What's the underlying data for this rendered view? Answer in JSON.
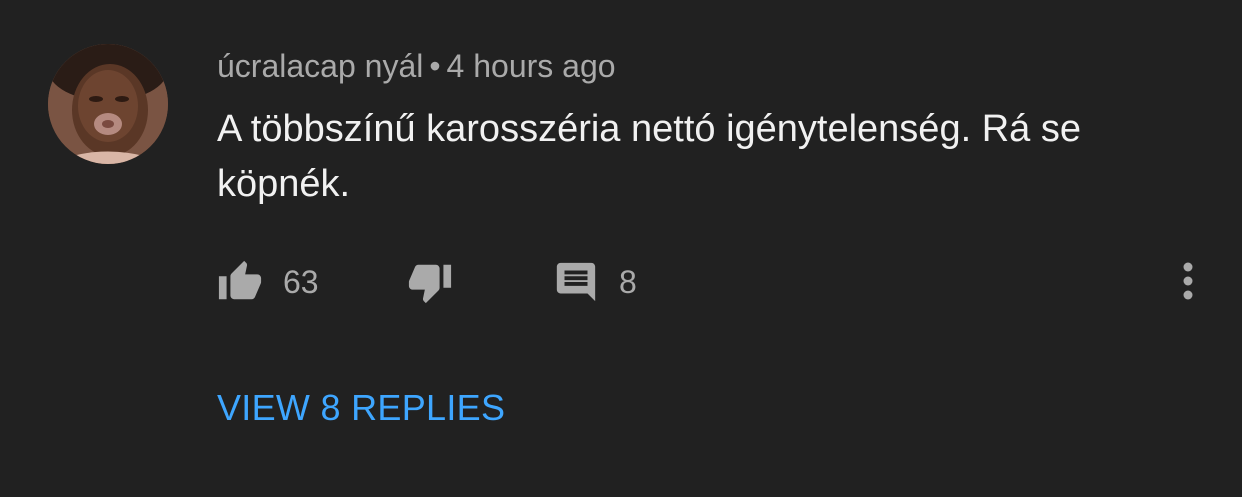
{
  "comment": {
    "author": "úcralacap nyál",
    "separator": "•",
    "timestamp": "4 hours ago",
    "text": "A többszínű karosszéria nettó igénytelenség. Rá se köpnék.",
    "like_count": "63",
    "reply_count": "8",
    "view_replies_label": "VIEW 8 REPLIES",
    "icons": {
      "avatar": "avatar",
      "like": "thumbs-up-icon",
      "dislike": "thumbs-down-icon",
      "reply": "comment-icon",
      "more": "more-vertical-icon"
    },
    "colors": {
      "background": "#212121",
      "text": "#f1f1f1",
      "secondary": "#aaaaaa",
      "link": "#3ea6ff"
    }
  }
}
